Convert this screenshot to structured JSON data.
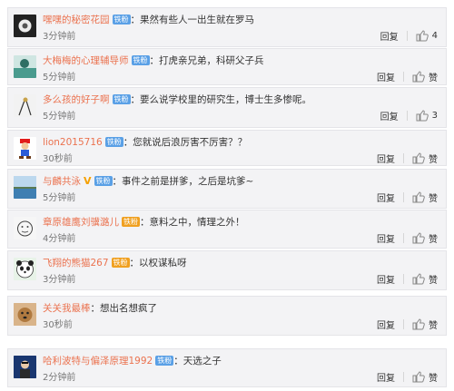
{
  "comments": [
    {
      "name": "嘿嘿的秘密花园",
      "badge": "铁粉",
      "text": "：果然有些人一出生就在罗马",
      "time": "3分钟前",
      "reply": "回复",
      "like": "4"
    },
    {
      "name": "大梅梅的心理辅导师",
      "badge": "铁粉",
      "text": "：打虎亲兄弟，科研父子兵",
      "time": "5分钟前",
      "reply": "回复",
      "like": "赞"
    },
    {
      "name": "多么孩的好子啊",
      "badge": "铁粉",
      "text": "：要么说学校里的研究生，博士生多惨呢。",
      "time": "5分钟前",
      "reply": "回复",
      "like": "3"
    },
    {
      "name": "lion2015716",
      "badge": "铁粉",
      "text": "：您就说后浪厉害不厉害？？",
      "time": "30秒前",
      "reply": "回复",
      "like": "赞"
    },
    {
      "name": "与麟共泳",
      "badge": "铁粉",
      "text": "：事件之前是拼爹，之后是坑爹~",
      "time": "5分钟前",
      "reply": "回复",
      "like": "赞"
    },
    {
      "name": "章原雄鹰刘骥潞儿",
      "badge": "铁粉",
      "text": "：意料之中，情理之外！",
      "time": "4分钟前",
      "reply": "回复",
      "like": "赞"
    },
    {
      "name": "飞翔的熊猫267",
      "badge": "铁粉",
      "text": "：以权谋私呀",
      "time": "3分钟前",
      "reply": "回复",
      "like": "赞"
    },
    {
      "name": "关关我最棒",
      "badge": "",
      "text": "：想出名想疯了",
      "time": "30秒前",
      "reply": "回复",
      "like": "赞"
    },
    {
      "name": "哈利波特与偏泽原理1992",
      "badge": "铁粉",
      "text": "：天选之子",
      "time": "2分钟前",
      "reply": "回复",
      "like": "赞"
    }
  ]
}
